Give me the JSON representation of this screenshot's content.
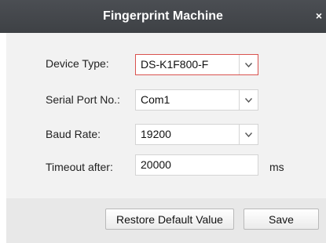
{
  "window": {
    "title": "Fingerprint Machine",
    "close_glyph": "×"
  },
  "form": {
    "device_type": {
      "label": "Device Type:",
      "value": "DS-K1F800-F"
    },
    "serial_port": {
      "label": "Serial Port No.:",
      "value": "Com1"
    },
    "baud_rate": {
      "label": "Baud Rate:",
      "value": "19200"
    },
    "timeout": {
      "label": "Timeout after:",
      "value": "20000",
      "unit": "ms"
    }
  },
  "buttons": {
    "restore_label": "Restore Default Value",
    "save_label": "Save"
  },
  "colors": {
    "titlebar": "#45484c",
    "focus_border": "#d9534f",
    "panel": "#f2f2f2"
  }
}
